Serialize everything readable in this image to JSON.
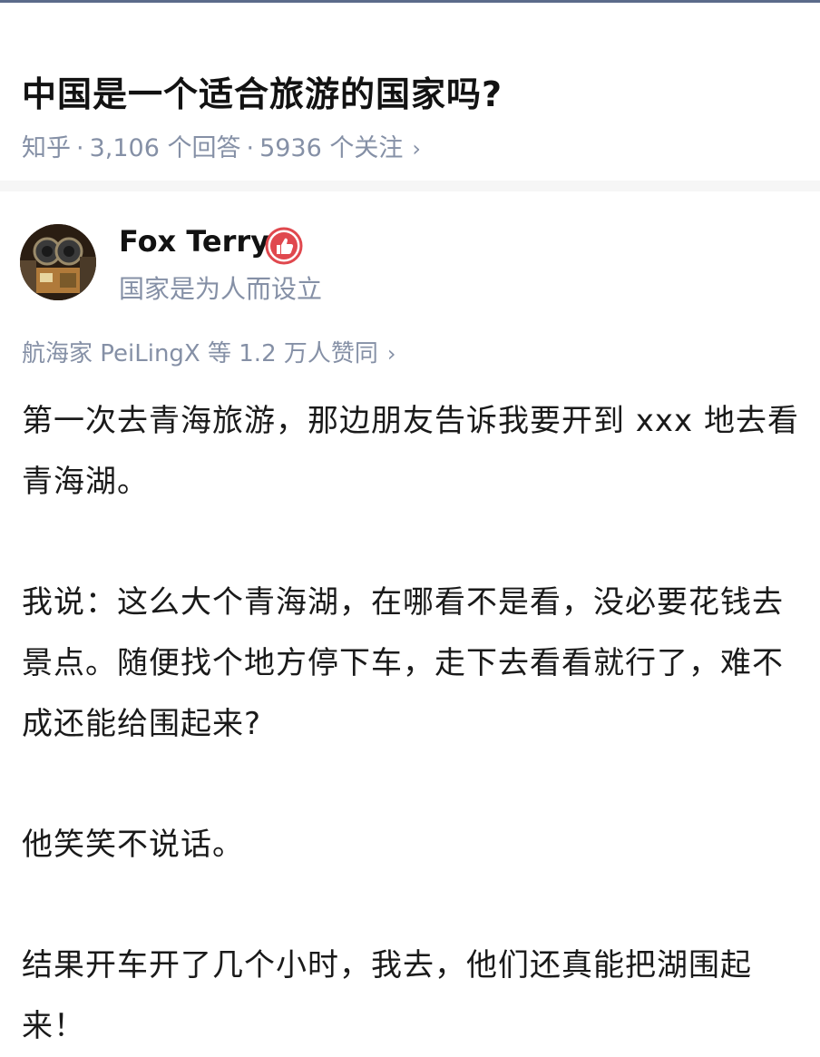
{
  "question": {
    "title": "中国是一个适合旅游的国家吗?",
    "source": "知乎",
    "separator": "·",
    "answers_count": "3,106 个回答",
    "followers_count": "5936 个关注",
    "chevron": "›"
  },
  "answer": {
    "author": {
      "name": "Fox Terry",
      "bio": "国家是为人而设立",
      "avatar_icon": "robot-avatar",
      "badge_icon": "thumbs-up-badge-icon",
      "badge_color": "#e0484e"
    },
    "voters_text": "航海家 PeiLingX 等 1.2 万人赞同",
    "voters_chevron": "›",
    "paragraphs": [
      "第一次去青海旅游，那边朋友告诉我要开到 xxx 地去看青海湖。",
      "我说：这么大个青海湖，在哪看不是看，没必要花钱去景点。随便找个地方停下车，走下去看看就行了，难不成还能给围起来?",
      "他笑笑不说话。",
      "结果开车开了几个小时，我去，他们还真能把湖围起来！"
    ]
  },
  "colors": {
    "meta_gray": "#8590a6",
    "divider": "#f6f6f6",
    "text": "#1a1a1a"
  }
}
